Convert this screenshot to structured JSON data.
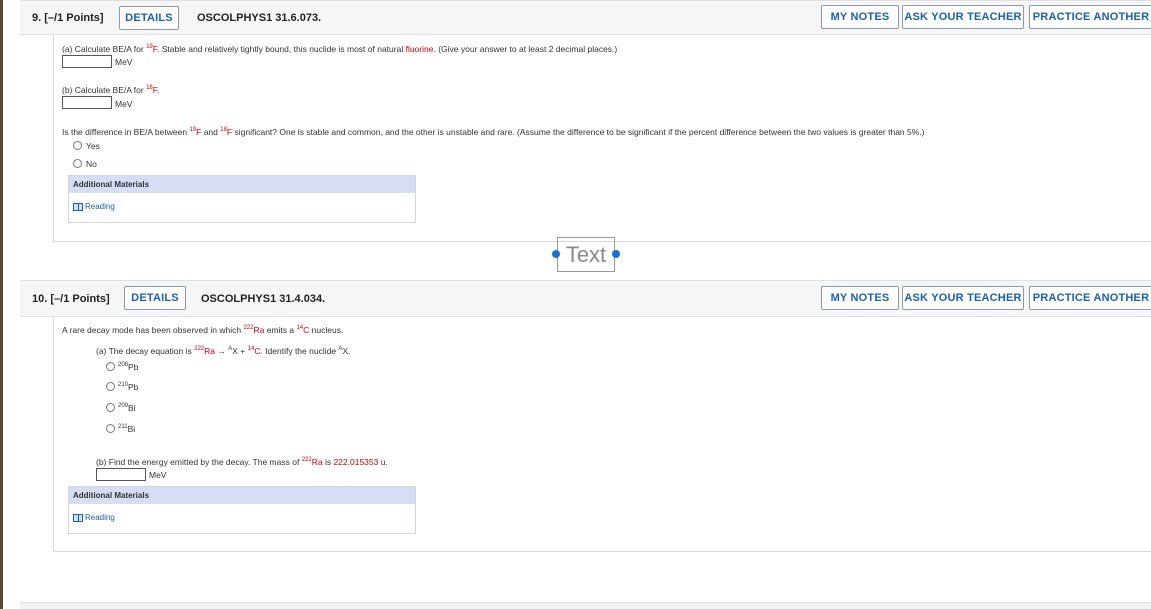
{
  "q9": {
    "number": "9.",
    "points": "[–/1 Points]",
    "details": "DETAILS",
    "id": "OSCOLPHYS1 31.6.073.",
    "my_notes": "MY NOTES",
    "ask_teacher": "ASK YOUR TEACHER",
    "practice": "PRACTICE ANOTHER",
    "part_a": {
      "pre": "(a) Calculate BE/A for ",
      "sup": "19",
      "nuclide": "F.",
      "mid": " Stable and relatively tightly bound, this nuclide is most of natural ",
      "link": "fluorine",
      "post": ". (Give your answer to at least 2 decimal places.)",
      "unit": "MeV"
    },
    "part_b": {
      "pre": "(b) Calculate BE/A for ",
      "sup": "18",
      "nuclide": "F.",
      "unit": "MeV"
    },
    "question": {
      "pre": "Is the difference in BE/A between ",
      "sup1": "19",
      "n1": "F",
      "and": " and ",
      "sup2": "18",
      "n2": "F",
      "post": " significant? One is stable and common, and the other is unstable and rare. (Assume the difference to be significant if the percent difference between the two values is greater than 5%.)"
    },
    "options": [
      "Yes",
      "No"
    ],
    "additional": "Additional Materials",
    "reading": "Reading"
  },
  "overlay": {
    "text": "Text"
  },
  "q10": {
    "number": "10.",
    "points": "[–/1 Points]",
    "details": "DETAILS",
    "id": "OSCOLPHYS1 31.4.034.",
    "my_notes": "MY NOTES",
    "ask_teacher": "ASK YOUR TEACHER",
    "practice": "PRACTICE ANOTHER",
    "intro": {
      "pre": "A rare decay mode has been observed in which ",
      "sup1": "222",
      "n1": "Ra",
      "mid": " emits a ",
      "sup2": "14",
      "n2": "C",
      "post": " nucleus."
    },
    "part_a": {
      "pre": "(a) The decay equation is ",
      "sup1": "222",
      "n1": "Ra",
      "arrow": " → ",
      "supA": "A",
      "x": "X + ",
      "sup2": "14",
      "n2": "C.",
      "post": " Identify the nuclide ",
      "supA2": "A",
      "x2": "X."
    },
    "choices": [
      {
        "sup": "208",
        "el": "Pb"
      },
      {
        "sup": "210",
        "el": "Pb"
      },
      {
        "sup": "209",
        "el": "Bi"
      },
      {
        "sup": "211",
        "el": "Bi"
      }
    ],
    "part_b": {
      "pre": "(b) Find the energy emitted by the decay. The mass of ",
      "sup": "222",
      "n": "Ra",
      "mid": " is ",
      "mass": "222.015353",
      "post": " u.",
      "unit": "MeV"
    },
    "additional": "Additional Materials",
    "reading": "Reading"
  }
}
